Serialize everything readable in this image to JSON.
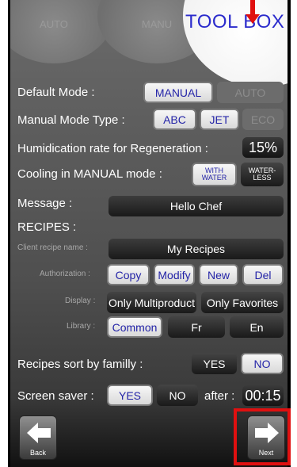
{
  "tabs": {
    "auto": "AUTO",
    "manu": "MANU",
    "toolbox": "TOOL BOX"
  },
  "default_mode": {
    "label": "Default Mode :",
    "options": [
      "MANUAL",
      "AUTO"
    ],
    "selected": "MANUAL"
  },
  "manual_mode_type": {
    "label": "Manual Mode Type :",
    "options": [
      "ABC",
      "JET",
      "ECO"
    ],
    "selected": [
      "ABC",
      "JET"
    ]
  },
  "humidication": {
    "label": "Humidication rate for Regeneration :",
    "value": "15%"
  },
  "cooling": {
    "label": "Cooling in MANUAL mode :",
    "with_water": [
      "WITH",
      "WATER"
    ],
    "waterless": [
      "WATER-",
      "LESS"
    ]
  },
  "message": {
    "label": "Message :",
    "value": "Hello Chef"
  },
  "recipes": {
    "heading": "RECIPES :",
    "client_recipe_name_label": "Client recipe name :",
    "client_recipe_name": "My Recipes",
    "authorization_label": "Authorization :",
    "authorization": [
      "Copy",
      "Modify",
      "New",
      "Del"
    ],
    "display_label": "Display :",
    "display": [
      "Only Multiproduct",
      "Only Favorites"
    ],
    "library_label": "Library :",
    "library": [
      "Common",
      "Fr",
      "En"
    ]
  },
  "sort_by_family": {
    "label": "Recipes sort by familly :",
    "yes": "YES",
    "no": "NO",
    "selected": "NO"
  },
  "screen_saver": {
    "label": "Screen saver :",
    "yes": "YES",
    "no": "NO",
    "selected": "YES",
    "after_label": "after :",
    "after_value": "00:15"
  },
  "nav": {
    "back": "Back",
    "next": "Next"
  },
  "colors": {
    "highlight": "#e01010",
    "selected_text": "#2424a8"
  }
}
